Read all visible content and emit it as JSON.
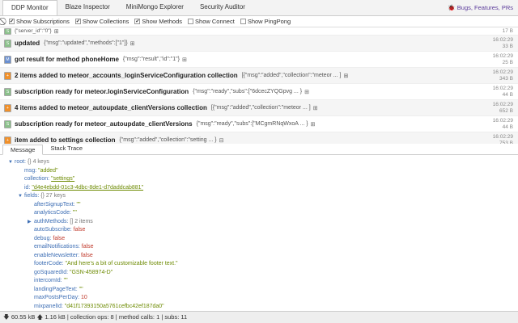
{
  "tabs": [
    {
      "label": "DDP Monitor"
    },
    {
      "label": "Blaze Inspector"
    },
    {
      "label": "MiniMongo Explorer"
    },
    {
      "label": "Security Auditor"
    }
  ],
  "bugs_link": "Bugs, Features, PRs",
  "filters": [
    {
      "label": "Show Subscriptions",
      "checked": true
    },
    {
      "label": "Show Collections",
      "checked": true
    },
    {
      "label": "Show Methods",
      "checked": true
    },
    {
      "label": "Show Connect",
      "checked": false
    },
    {
      "label": "Show PingPong",
      "checked": false
    }
  ],
  "log": [
    {
      "type": "sub",
      "title": "",
      "json": "{\"server_id\":\"0\"}",
      "time": "",
      "size": "17 B"
    },
    {
      "type": "sub",
      "title": "updated",
      "json": "{\"msg\":\"updated\",\"methods\":[\"1\"]}",
      "time": "16:02:29",
      "size": "33 B"
    },
    {
      "type": "met",
      "title": "got result for method phoneHome",
      "json": "{\"msg\":\"result\",\"id\":\"1\"}",
      "time": "16:02:29",
      "size": "25 B"
    },
    {
      "type": "col",
      "title": "2 items added to meteor_accounts_loginServiceConfiguration collection",
      "json": "[{\"msg\":\"added\",\"collection\":\"meteor ... ]",
      "time": "16:02:29",
      "size": "343 B"
    },
    {
      "type": "sub",
      "title": "subscription ready for meteor.loginServiceConfiguration",
      "json": "{\"msg\":\"ready\",\"subs\":[\"6dcecZYQGpvg ... }",
      "time": "16:02:29",
      "size": "44 B"
    },
    {
      "type": "col",
      "title": "4 items added to meteor_autoupdate_clientVersions collection",
      "json": "[{\"msg\":\"added\",\"collection\":\"meteor ... ]",
      "time": "16:02:29",
      "size": "652 B"
    },
    {
      "type": "sub",
      "title": "subscription ready for meteor_autoupdate_clientVersions",
      "json": "{\"msg\":\"ready\",\"subs\":[\"MCgmRNqWxoA ... }",
      "time": "16:02:29",
      "size": "44 B"
    },
    {
      "type": "col",
      "title": "item added to settings collection",
      "json": "{\"msg\":\"added\",\"collection\":\"setting ... }",
      "time": "16:02:29",
      "size": "753 B"
    }
  ],
  "detail_tabs": [
    {
      "label": "Message"
    },
    {
      "label": "Stack Trace"
    }
  ],
  "tree": [
    {
      "d": 0,
      "arrow": "down",
      "key": "root:",
      "meta": "{}  4 keys"
    },
    {
      "d": 1,
      "key": "msg:",
      "val": "\"added\"",
      "vt": "s"
    },
    {
      "d": 1,
      "key": "collection:",
      "val": "\"settings\"",
      "vt": "s"
    },
    {
      "d": 1,
      "key": "id:",
      "val": "\"d4e4ebdd-01c3-4dbc-8de1-d7daddcab881\"",
      "vt": "s"
    },
    {
      "d": 1,
      "arrow": "down",
      "key": "fields:",
      "meta": "{}  27 keys"
    },
    {
      "d": 2,
      "key": "afterSignupText:",
      "val": "\"\"",
      "vt": "s"
    },
    {
      "d": 2,
      "key": "analyticsCode:",
      "val": "\"\"",
      "vt": "s"
    },
    {
      "d": 2,
      "arrow": "right",
      "key": "authMethods:",
      "meta": "[]  2 items"
    },
    {
      "d": 2,
      "key": "autoSubscribe:",
      "val": "false",
      "vt": "b"
    },
    {
      "d": 2,
      "key": "debug:",
      "val": "false",
      "vt": "b"
    },
    {
      "d": 2,
      "key": "emailNotifications:",
      "val": "false",
      "vt": "b"
    },
    {
      "d": 2,
      "key": "enableNewsletter:",
      "val": "false",
      "vt": "b"
    },
    {
      "d": 2,
      "key": "footerCode:",
      "val": "\"And here's a bit of customizable footer text.\"",
      "vt": "s"
    },
    {
      "d": 2,
      "key": "goSquaredId:",
      "val": "\"GSN-458974-D\"",
      "vt": "s"
    },
    {
      "d": 2,
      "key": "intercomId:",
      "val": "\"\"",
      "vt": "s"
    },
    {
      "d": 2,
      "key": "landingPageText:",
      "val": "\"\"",
      "vt": "s"
    },
    {
      "d": 2,
      "key": "maxPostsPerDay:",
      "val": "10",
      "vt": "n"
    },
    {
      "d": 2,
      "key": "mixpanelId:",
      "val": "\"d41f17393150a5761cefbc42ef187da0\"",
      "vt": "s"
    }
  ],
  "footer": {
    "down": "60.55 kB",
    "up": "1.16 kB",
    "collection_ops": "collection ops: 8",
    "method_calls": "method calls: 1",
    "subs": "subs: 11"
  }
}
